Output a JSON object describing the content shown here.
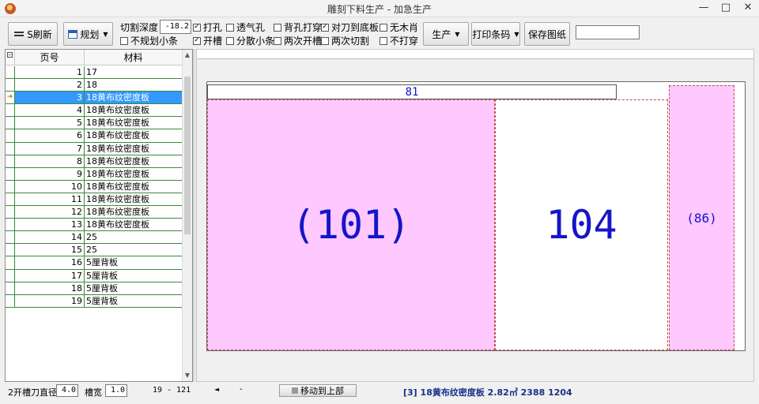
{
  "window": {
    "title": "雕刻下料生产 - 加急生产",
    "minimize_symbol": "—",
    "maximize_symbol": "□",
    "close_symbol": "✕",
    "icon": "app-logo-icon"
  },
  "toolbar": {
    "refresh_label": "S刷新",
    "plan_label": "规划",
    "cut_depth_label": "切割深度",
    "cut_depth_value": "-18.2",
    "checkboxes": [
      {
        "label": "打孔",
        "checked": true
      },
      {
        "label": "透气孔",
        "checked": false
      },
      {
        "label": "背孔打穿",
        "checked": false
      },
      {
        "label": "对刀到底板",
        "checked": true
      },
      {
        "label": "无木肖",
        "checked": false
      },
      {
        "label": "不规划小条",
        "checked": false
      },
      {
        "label": "开槽",
        "checked": true
      },
      {
        "label": "分散小条",
        "checked": false
      },
      {
        "label": "两次开槽",
        "checked": false
      },
      {
        "label": "两次切割",
        "checked": false
      },
      {
        "label": "不打穿",
        "checked": false
      }
    ],
    "produce_label": "生产",
    "print_barcode_label": "打印条码",
    "save_drawing_label": "保存图纸",
    "search_value": ""
  },
  "grid": {
    "columns": [
      "页号",
      "材料"
    ],
    "rows": [
      {
        "page": "1",
        "material": "17"
      },
      {
        "page": "2",
        "material": "18"
      },
      {
        "page": "3",
        "material": "18黄布纹密度板"
      },
      {
        "page": "4",
        "material": "18黄布纹密度板"
      },
      {
        "page": "5",
        "material": "18黄布纹密度板"
      },
      {
        "page": "6",
        "material": "18黄布纹密度板"
      },
      {
        "page": "7",
        "material": "18黄布纹密度板"
      },
      {
        "page": "8",
        "material": "18黄布纹密度板"
      },
      {
        "page": "9",
        "material": "18黄布纹密度板"
      },
      {
        "page": "10",
        "material": "18黄布纹密度板"
      },
      {
        "page": "11",
        "material": "18黄布纹密度板"
      },
      {
        "page": "12",
        "material": "18黄布纹密度板"
      },
      {
        "page": "13",
        "material": "18黄布纹密度板"
      },
      {
        "page": "14",
        "material": "25"
      },
      {
        "page": "15",
        "material": "25"
      },
      {
        "page": "16",
        "material": "5厘背板"
      },
      {
        "page": "17",
        "material": "5厘背板"
      },
      {
        "page": "18",
        "material": "5厘背板"
      },
      {
        "page": "19",
        "material": "5厘背板"
      }
    ],
    "selected_index": 2,
    "current_row_marker": "➔",
    "collapse_symbol": "−"
  },
  "canvas": {
    "strip_label": "81",
    "pieces": [
      {
        "label": "(101)",
        "color": "#ffc8ff"
      },
      {
        "label": "104",
        "color": "#ffffff"
      },
      {
        "label": "(86)",
        "color": "#ffc8ff"
      }
    ],
    "text_color": "#1515c8"
  },
  "status": {
    "cutter_label": "2开槽刀直径",
    "cutter_value": "4.0",
    "slot_width_label": "槽宽",
    "slot_width_value": "1.0",
    "range_text": "19 - 121",
    "left_arrow": "◄",
    "dash": "-",
    "move_top_label": "移动到上部",
    "sheet_info": "[3] 18黄布纹密度板 2.82㎡ 2388 1204"
  }
}
